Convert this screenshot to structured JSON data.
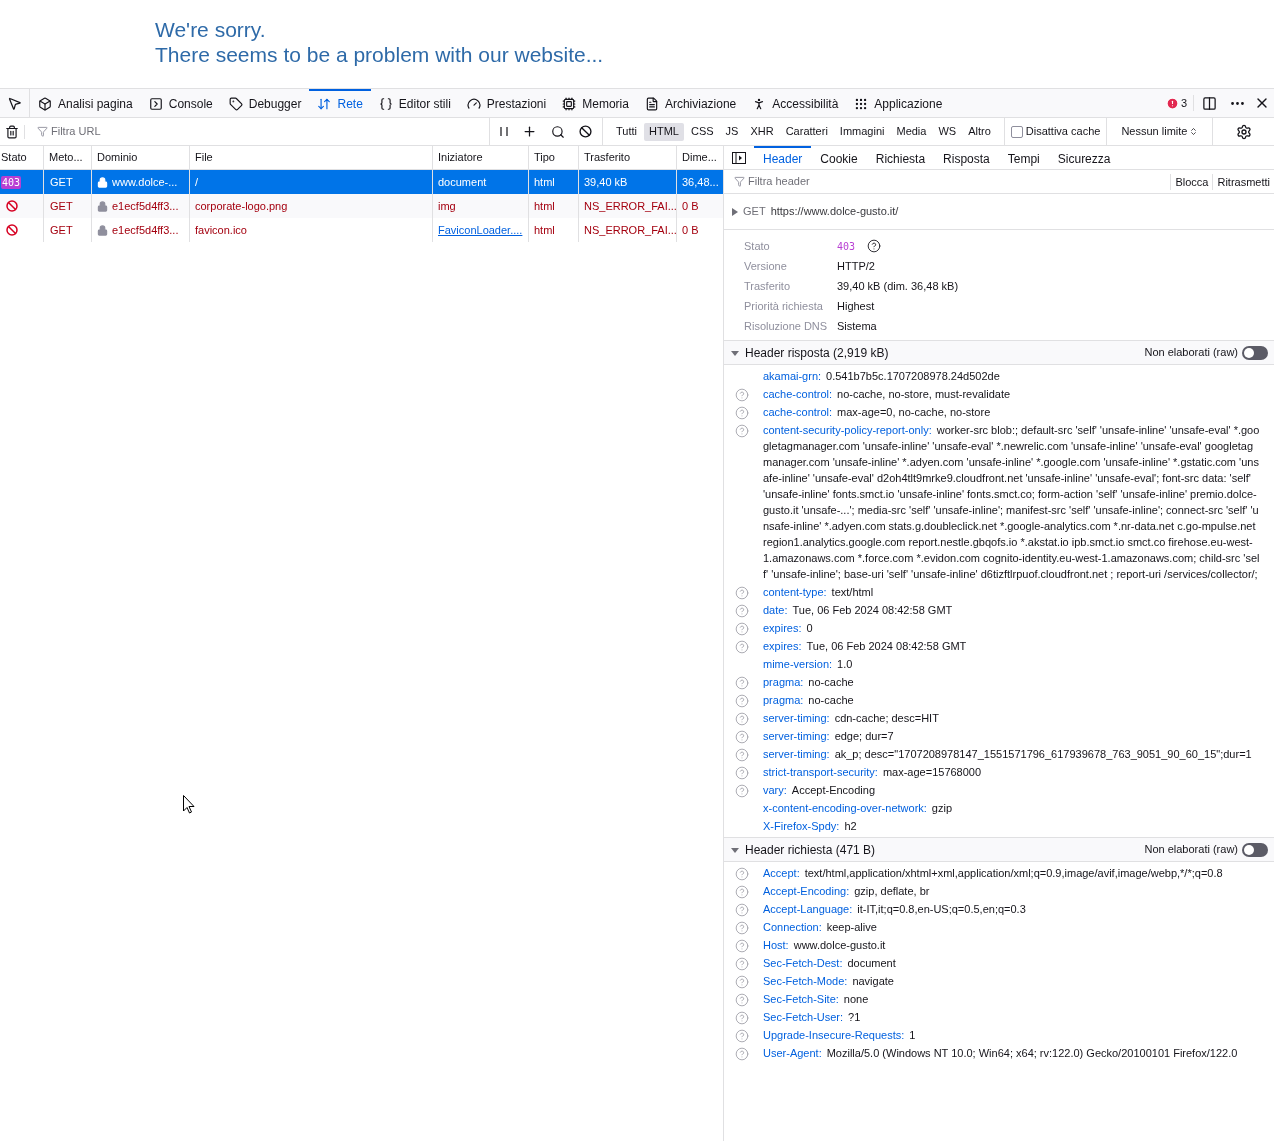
{
  "page_message": {
    "lines": [
      "We're sorry.",
      "There seems to be a problem with our website..."
    ]
  },
  "toolbar": {
    "tabs": [
      {
        "label": "Analisi pagina",
        "selected": false
      },
      {
        "label": "Console",
        "selected": false
      },
      {
        "label": "Debugger",
        "selected": false
      },
      {
        "label": "Rete",
        "selected": true
      },
      {
        "label": "Editor stili",
        "selected": false
      },
      {
        "label": "Prestazioni",
        "selected": false
      },
      {
        "label": "Memoria",
        "selected": false
      },
      {
        "label": "Archiviazione",
        "selected": false
      },
      {
        "label": "Accessibilità",
        "selected": false
      },
      {
        "label": "Applicazione",
        "selected": false
      }
    ],
    "error_count": "3"
  },
  "filter_bar": {
    "url_placeholder": "Filtra URL",
    "types": [
      {
        "label": "Tutti",
        "selected": false
      },
      {
        "label": "HTML",
        "selected": true
      },
      {
        "label": "CSS",
        "selected": false
      },
      {
        "label": "JS",
        "selected": false
      },
      {
        "label": "XHR",
        "selected": false
      },
      {
        "label": "Caratteri",
        "selected": false
      },
      {
        "label": "Immagini",
        "selected": false
      },
      {
        "label": "Media",
        "selected": false
      },
      {
        "label": "WS",
        "selected": false
      },
      {
        "label": "Altro",
        "selected": false
      }
    ],
    "disable_cache": {
      "label": "Disattiva cache",
      "checked": false
    },
    "throttling": "Nessun limite"
  },
  "table": {
    "columns": [
      "Stato",
      "Meto...",
      "Dominio",
      "File",
      "Iniziatore",
      "Tipo",
      "Trasferito",
      "Dime..."
    ],
    "rows": [
      {
        "kind": "ok",
        "status": "403",
        "method": "GET",
        "domain": "www.dolce-...",
        "file": "/",
        "initiator": "document",
        "initiator_link": false,
        "type": "html",
        "transferred": "39,40 kB",
        "size": "36,48...",
        "selected": true
      },
      {
        "kind": "blocked",
        "method": "GET",
        "domain": "e1ecf5d4ff3...",
        "file": "corporate-logo.png",
        "initiator": "img",
        "initiator_link": false,
        "type": "html",
        "transferred": "NS_ERROR_FAI...",
        "size": "0 B",
        "selected": false
      },
      {
        "kind": "blocked",
        "method": "GET",
        "domain": "e1ecf5d4ff3...",
        "file": "favicon.ico",
        "initiator": "FaviconLoader....",
        "initiator_link": true,
        "type": "html",
        "transferred": "NS_ERROR_FAI...",
        "size": "0 B",
        "selected": false
      }
    ]
  },
  "details": {
    "tabs": [
      {
        "label": "Header",
        "selected": true
      },
      {
        "label": "Cookie",
        "selected": false
      },
      {
        "label": "Richiesta",
        "selected": false
      },
      {
        "label": "Risposta",
        "selected": false
      },
      {
        "label": "Tempi",
        "selected": false
      },
      {
        "label": "Sicurezza",
        "selected": false
      }
    ],
    "filter_placeholder": "Filtra header",
    "actions": [
      "Blocca",
      "Ritrasmetti"
    ],
    "request_line": {
      "method": "GET",
      "url": "https://www.dolce-gusto.it/"
    },
    "summary": [
      {
        "label": "Stato",
        "value": "403",
        "kind": "status"
      },
      {
        "label": "Versione",
        "value": "HTTP/2",
        "kind": "text"
      },
      {
        "label": "Trasferito",
        "value": "39,40 kB (dim. 36,48 kB)",
        "kind": "text"
      },
      {
        "label": "Priorità richiesta",
        "value": "Highest",
        "kind": "text"
      },
      {
        "label": "Risoluzione DNS",
        "value": "Sistema",
        "kind": "text"
      }
    ],
    "sections": [
      {
        "title": "Header risposta (2,919 kB)",
        "expanded": true,
        "raw_label": "Non elaborati (raw)",
        "raw_on": false,
        "headers": [
          {
            "name": "akamai-grn:",
            "value": "0.541b7b5c.1707208978.24d502de",
            "help": false
          },
          {
            "name": "cache-control:",
            "value": "no-cache, no-store, must-revalidate",
            "help": true
          },
          {
            "name": "cache-control:",
            "value": "max-age=0, no-cache, no-store",
            "help": true
          },
          {
            "name": "content-security-policy-report-only:",
            "value": "worker-src blob:; default-src 'self' 'unsafe-inline' 'unsafe-eval' *.googletagmanager.com 'unsafe-inline' 'unsafe-eval' *.newrelic.com 'unsafe-inline' 'unsafe-eval' googletagmanager.com 'unsafe-inline' *.adyen.com 'unsafe-inline' *.google.com 'unsafe-inline' *.gstatic.com 'unsafe-inline' 'unsafe-eval' d2oh4tlt9mrke9.cloudfront.net 'unsafe-inline' 'unsafe-eval'; font-src data: 'self' 'unsafe-inline' fonts.smct.io 'unsafe-inline' fonts.smct.co; form-action 'self' 'unsafe-inline' premio.dolce-gusto.it 'unsafe-...'; media-src 'self' 'unsafe-inline'; manifest-src 'self' 'unsafe-inline'; connect-src 'self' 'unsafe-inline' *.adyen.com stats.g.doubleclick.net *.google-analytics.com *.nr-data.net c.go-mpulse.net region1.analytics.google.com report.nestle.gbqofs.io *.akstat.io ipb.smct.io smct.co firehose.eu-west-1.amazonaws.com *.force.com *.evidon.com cognito-identity.eu-west-1.amazonaws.com; child-src 'self' 'unsafe-inline'; base-uri 'self' 'unsafe-inline' d6tizftlrpuof.cloudfront.net ; report-uri /services/collector/;",
            "help": true
          },
          {
            "name": "content-type:",
            "value": "text/html",
            "help": true
          },
          {
            "name": "date:",
            "value": "Tue, 06 Feb 2024 08:42:58 GMT",
            "help": true
          },
          {
            "name": "expires:",
            "value": "0",
            "help": true
          },
          {
            "name": "expires:",
            "value": "Tue, 06 Feb 2024 08:42:58 GMT",
            "help": true
          },
          {
            "name": "mime-version:",
            "value": "1.0",
            "help": false
          },
          {
            "name": "pragma:",
            "value": "no-cache",
            "help": true
          },
          {
            "name": "pragma:",
            "value": "no-cache",
            "help": true
          },
          {
            "name": "server-timing:",
            "value": "cdn-cache; desc=HIT",
            "help": true
          },
          {
            "name": "server-timing:",
            "value": "edge; dur=7",
            "help": true
          },
          {
            "name": "server-timing:",
            "value": "ak_p; desc=\"1707208978147_1551571796_617939678_763_9051_90_60_15\";dur=1",
            "help": true
          },
          {
            "name": "strict-transport-security:",
            "value": "max-age=15768000",
            "help": true
          },
          {
            "name": "vary:",
            "value": "Accept-Encoding",
            "help": true
          },
          {
            "name": "x-content-encoding-over-network:",
            "value": "gzip",
            "help": false
          },
          {
            "name": "X-Firefox-Spdy:",
            "value": "h2",
            "help": false
          }
        ]
      },
      {
        "title": "Header richiesta (471 B)",
        "expanded": true,
        "raw_label": "Non elaborati (raw)",
        "raw_on": false,
        "headers": [
          {
            "name": "Accept:",
            "value": "text/html,application/xhtml+xml,application/xml;q=0.9,image/avif,image/webp,*/*;q=0.8",
            "help": true
          },
          {
            "name": "Accept-Encoding:",
            "value": "gzip, deflate, br",
            "help": true
          },
          {
            "name": "Accept-Language:",
            "value": "it-IT,it;q=0.8,en-US;q=0.5,en;q=0.3",
            "help": true
          },
          {
            "name": "Connection:",
            "value": "keep-alive",
            "help": true
          },
          {
            "name": "Host:",
            "value": "www.dolce-gusto.it",
            "help": true
          },
          {
            "name": "Sec-Fetch-Dest:",
            "value": "document",
            "help": true
          },
          {
            "name": "Sec-Fetch-Mode:",
            "value": "navigate",
            "help": true
          },
          {
            "name": "Sec-Fetch-Site:",
            "value": "none",
            "help": true
          },
          {
            "name": "Sec-Fetch-User:",
            "value": "?1",
            "help": true
          },
          {
            "name": "Upgrade-Insecure-Requests:",
            "value": "1",
            "help": true
          },
          {
            "name": "User-Agent:",
            "value": "Mozilla/5.0 (Windows NT 10.0; Win64; x64; rv:122.0) Gecko/20100101 Firefox/122.0",
            "help": true
          }
        ]
      }
    ]
  }
}
